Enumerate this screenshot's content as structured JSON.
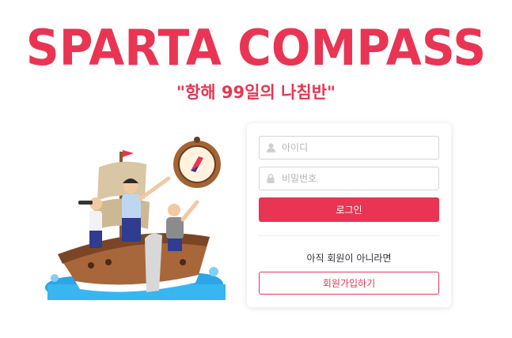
{
  "header": {
    "logo_text": "SPARTA COMPASS",
    "tagline": "\"항해 99일의 나침반\""
  },
  "login": {
    "id_placeholder": "아이디",
    "password_placeholder": "비밀번호",
    "login_label": "로그인",
    "signup_prompt": "아직 회원이 아니라면",
    "signup_label": "회원가입하기"
  },
  "colors": {
    "brand": "#e93553",
    "border": "#d6d6d6"
  },
  "icons": {
    "id_field": "user-icon",
    "password_field": "lock-icon"
  }
}
